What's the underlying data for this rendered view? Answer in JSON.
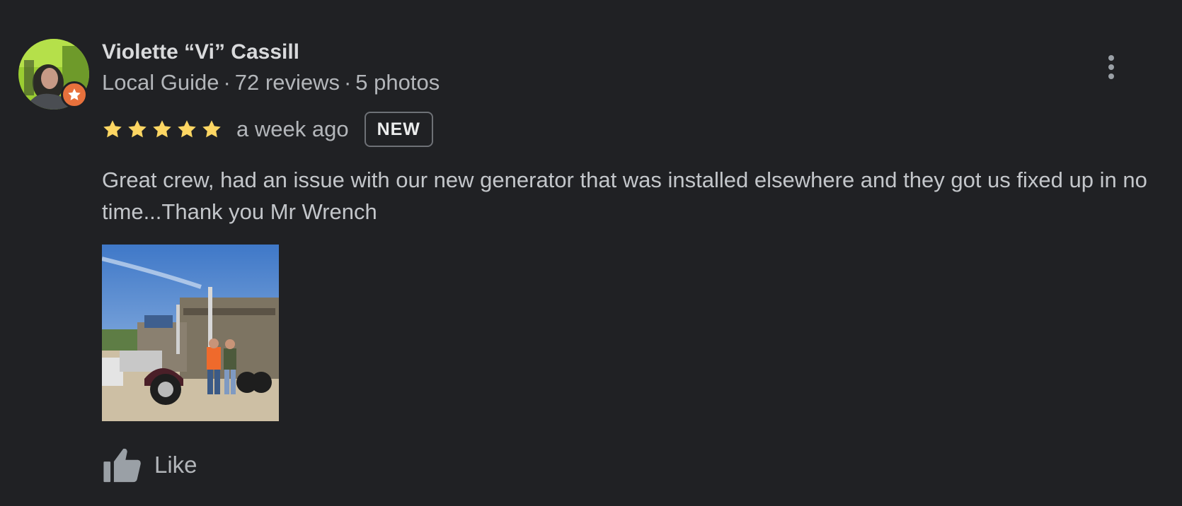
{
  "author": {
    "name": "Violette “Vi” Cassill",
    "guide_label": "Local Guide",
    "separator": "·",
    "reviews": "72 reviews",
    "photos": "5 photos",
    "avatar_icon": "user-avatar-photo",
    "badge_icon": "local-guide-star-icon"
  },
  "review": {
    "rating": 5,
    "rating_max": 5,
    "time": "a week ago",
    "badge": "NEW",
    "text": "Great crew, had an issue with our new generator that was installed elsewhere and they got us fixed up in no time...Thank you Mr Wrench",
    "photo_icon": "review-photo-truck"
  },
  "actions": {
    "like_label": "Like",
    "like_icon": "thumbs-up-icon",
    "more_icon": "more-vertical-icon"
  },
  "colors": {
    "background": "#202124",
    "star": "#fdd663",
    "badge_orange": "#e8713c"
  }
}
